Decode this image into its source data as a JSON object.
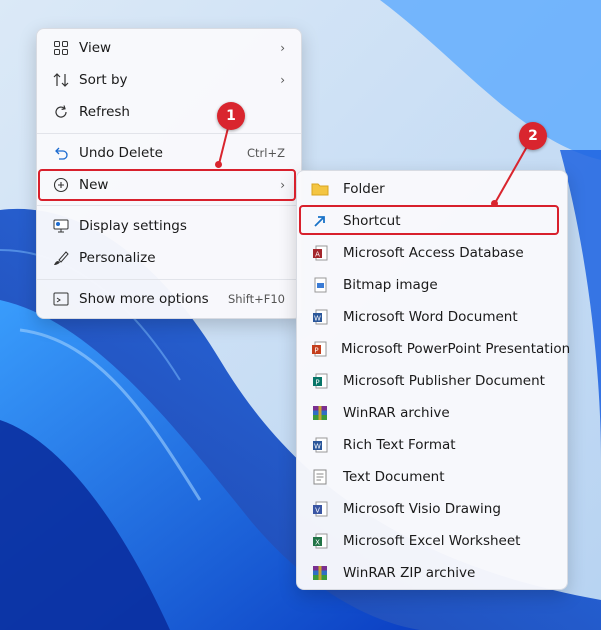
{
  "context_menu": {
    "items": [
      {
        "label": "View",
        "icon": "grid-icon",
        "submenu": true
      },
      {
        "label": "Sort by",
        "icon": "sort-icon",
        "submenu": true
      },
      {
        "label": "Refresh",
        "icon": "refresh-icon"
      },
      {
        "label": "Undo Delete",
        "icon": "undo-icon",
        "shortcut": "Ctrl+Z"
      },
      {
        "label": "New",
        "icon": "plus-circle-icon",
        "submenu": true
      },
      {
        "label": "Display settings",
        "icon": "monitor-icon"
      },
      {
        "label": "Personalize",
        "icon": "brush-icon"
      },
      {
        "label": "Show more options",
        "icon": "more-options-icon",
        "shortcut": "Shift+F10"
      }
    ]
  },
  "new_submenu": {
    "items": [
      {
        "label": "Folder",
        "icon": "folder-icon",
        "color": "#f4c542"
      },
      {
        "label": "Shortcut",
        "icon": "shortcut-arrow-icon",
        "color": "#1a73c8"
      },
      {
        "label": "Microsoft Access Database",
        "icon": "access-icon",
        "color": "#a4262c"
      },
      {
        "label": "Bitmap image",
        "icon": "bitmap-icon",
        "color": "#3a7bd5"
      },
      {
        "label": "Microsoft Word Document",
        "icon": "word-icon",
        "color": "#2b579a"
      },
      {
        "label": "Microsoft PowerPoint Presentation",
        "icon": "powerpoint-icon",
        "color": "#c43e1c"
      },
      {
        "label": "Microsoft Publisher Document",
        "icon": "publisher-icon",
        "color": "#077568"
      },
      {
        "label": "WinRAR archive",
        "icon": "winrar-icon",
        "color": "#7a2f8f"
      },
      {
        "label": "Rich Text Format",
        "icon": "rtf-icon",
        "color": "#2b579a"
      },
      {
        "label": "Text Document",
        "icon": "text-document-icon",
        "color": "#8a8a8a"
      },
      {
        "label": "Microsoft Visio Drawing",
        "icon": "visio-icon",
        "color": "#3955a3"
      },
      {
        "label": "Microsoft Excel Worksheet",
        "icon": "excel-icon",
        "color": "#217346"
      },
      {
        "label": "WinRAR ZIP archive",
        "icon": "winrar-zip-icon",
        "color": "#7a2f8f"
      }
    ]
  },
  "annotations": {
    "step1": "1",
    "step2": "2",
    "color": "#d9252e"
  }
}
